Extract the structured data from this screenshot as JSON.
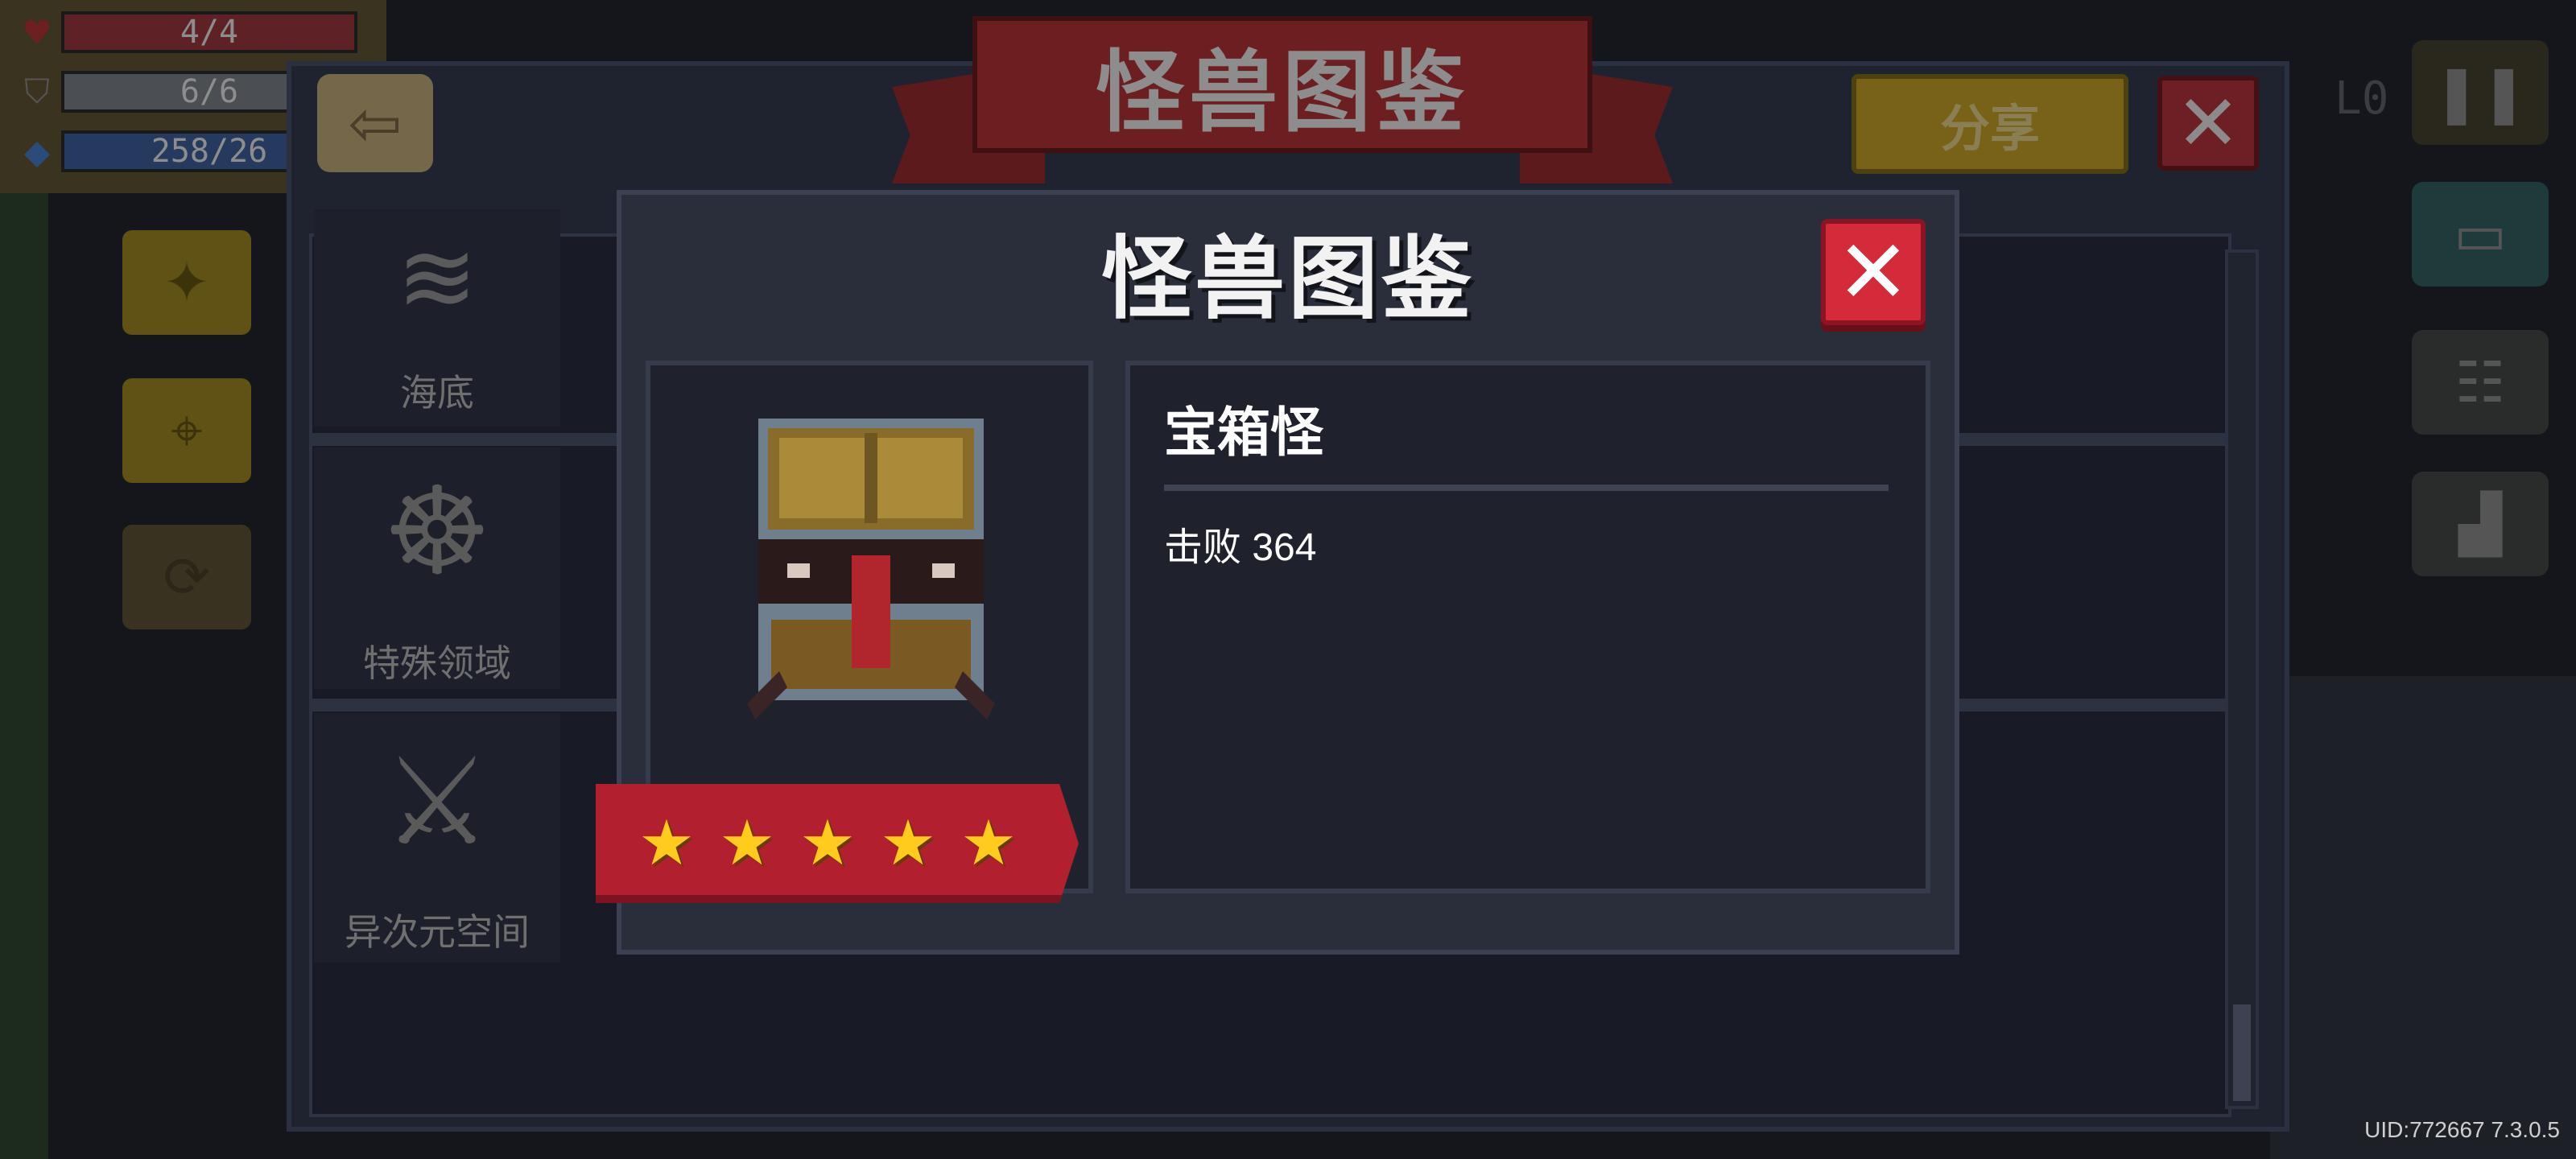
{
  "hud": {
    "health": "4/4",
    "armor": "6/6",
    "energy": "258/26",
    "health_color": "#c93033",
    "armor_color": "#9aa1a8",
    "energy_color": "#3a77d8",
    "right_top_text": "L0"
  },
  "background_screen": {
    "title": "怪兽图鉴",
    "share_label": "分享",
    "categories": [
      {
        "label": "海底",
        "icon": "wave-icon"
      },
      {
        "label": "特殊领域",
        "icon": "lion-mask-icon"
      },
      {
        "label": "异次元空间",
        "icon": "knight-swords-icon"
      }
    ]
  },
  "modal": {
    "title": "怪兽图鉴",
    "monster_name": "宝箱怪",
    "defeat_text": "击败 364",
    "rating": 5,
    "star_icon": "★",
    "close_symbol": "✕"
  },
  "uid_text": "UID:772667 7.3.0.5",
  "colors": {
    "modal_bg": "#2a2e3b",
    "close_red": "#d42a3a",
    "ribbon_red": "#b21f2f",
    "star_gold": "#ffcc1d"
  }
}
